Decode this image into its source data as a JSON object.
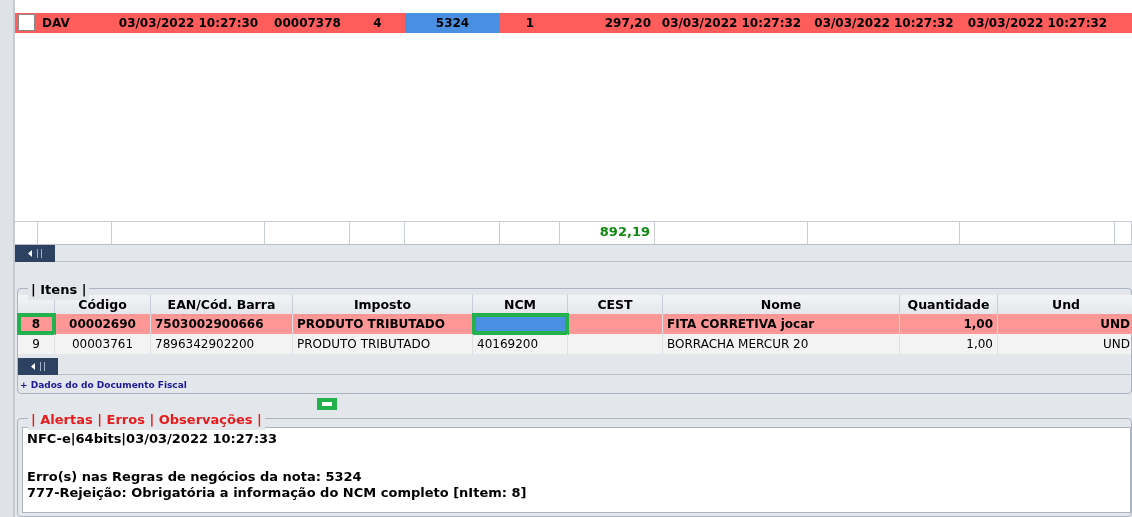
{
  "documents_grid": {
    "rows": [
      {
        "error": true,
        "checked": false,
        "cells": [
          {
            "text": "DAV",
            "highlighted": false
          },
          {
            "text": "03/03/2022 10:27:30",
            "highlighted": false
          },
          {
            "text": "00007378",
            "highlighted": false
          },
          {
            "text": "4",
            "highlighted": false
          },
          {
            "text": "5324",
            "highlighted": true
          },
          {
            "text": "1",
            "highlighted": false
          },
          {
            "text": "297,20",
            "highlighted": false
          },
          {
            "text": "03/03/2022 10:27:32",
            "highlighted": false
          },
          {
            "text": "03/03/2022 10:27:32",
            "highlighted": false
          },
          {
            "text": "03/03/2022 10:27:32",
            "highlighted": false
          }
        ]
      }
    ],
    "total": "892,19"
  },
  "items": {
    "title": "| Itens |",
    "columns": [
      "Código",
      "EAN/Cód. Barra",
      "Imposto",
      "NCM",
      "CEST",
      "Nome",
      "Quantidade",
      "Und"
    ],
    "rows": [
      {
        "error": true,
        "number": {
          "text": "8",
          "annotated": true
        },
        "cells": [
          {
            "text": "00002690",
            "highlighted": false,
            "annotated": false
          },
          {
            "text": "7503002900666",
            "highlighted": false,
            "annotated": false
          },
          {
            "text": "PRODUTO TRIBUTADO",
            "highlighted": false,
            "annotated": false
          },
          {
            "highlighted": true,
            "annotated": true
          },
          {
            "highlighted": false,
            "annotated": false
          },
          {
            "text": "FITA CORRETIVA jocar",
            "highlighted": false,
            "annotated": false
          },
          {
            "text": "1,00",
            "highlighted": false,
            "annotated": false
          },
          {
            "text": "UND",
            "highlighted": false,
            "annotated": false
          }
        ]
      },
      {
        "error": false,
        "number": {
          "text": "9",
          "annotated": false
        },
        "cells": [
          {
            "text": "00003761",
            "highlighted": false,
            "annotated": false
          },
          {
            "text": "7896342902200",
            "highlighted": false,
            "annotated": false
          },
          {
            "text": "PRODUTO TRIBUTADO",
            "highlighted": false,
            "annotated": false
          },
          {
            "text": "40169200",
            "highlighted": false,
            "annotated": false
          },
          {
            "highlighted": false,
            "annotated": false
          },
          {
            "text": "BORRACHA MERCUR  20",
            "highlighted": false,
            "annotated": false
          },
          {
            "text": "1,00",
            "highlighted": false,
            "annotated": false
          },
          {
            "text": "UND",
            "highlighted": false,
            "annotated": false
          }
        ]
      }
    ],
    "link": "+ Dados do do Documento Fiscal"
  },
  "messages": {
    "title": "| Alertas | Erros | Observações |",
    "lines": [
      "NFC-e|64bits|03/03/2022 10:27:33",
      "Erro(s) nas Regras de negócios da nota: 5324",
      "777-Rejeição: Obrigatória a informação do NCM completo [nItem: 8]"
    ]
  }
}
